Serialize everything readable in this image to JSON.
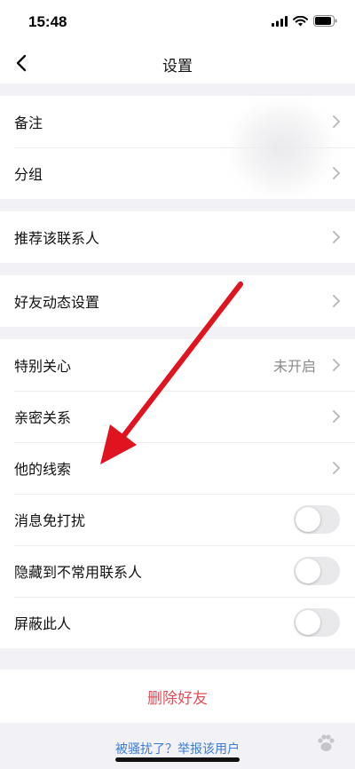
{
  "status": {
    "time": "15:48"
  },
  "nav": {
    "title": "设置"
  },
  "groups": {
    "g1": [
      "备注",
      "分组"
    ],
    "g2": [
      "推荐该联系人"
    ],
    "g3": [
      "好友动态设置"
    ],
    "g4": {
      "special_care": {
        "label": "特别关心",
        "value": "未开启"
      },
      "intimacy": "亲密关系",
      "clues": "他的线索",
      "dnd": {
        "label": "消息免打扰",
        "on": false
      },
      "hide": {
        "label": "隐藏到不常用联系人",
        "on": false
      },
      "block": {
        "label": "屏蔽此人",
        "on": false
      }
    }
  },
  "actions": {
    "delete": "删除好友",
    "report": "被骚扰了？举报该用户"
  },
  "colors": {
    "delete": "#e0505a",
    "link": "#3a7bd5",
    "arrow": "#e0141e"
  },
  "icons": [
    "back-chevron-icon",
    "chevron-right-icon",
    "signal-icon",
    "wifi-icon",
    "battery-icon",
    "annotation-arrow"
  ]
}
